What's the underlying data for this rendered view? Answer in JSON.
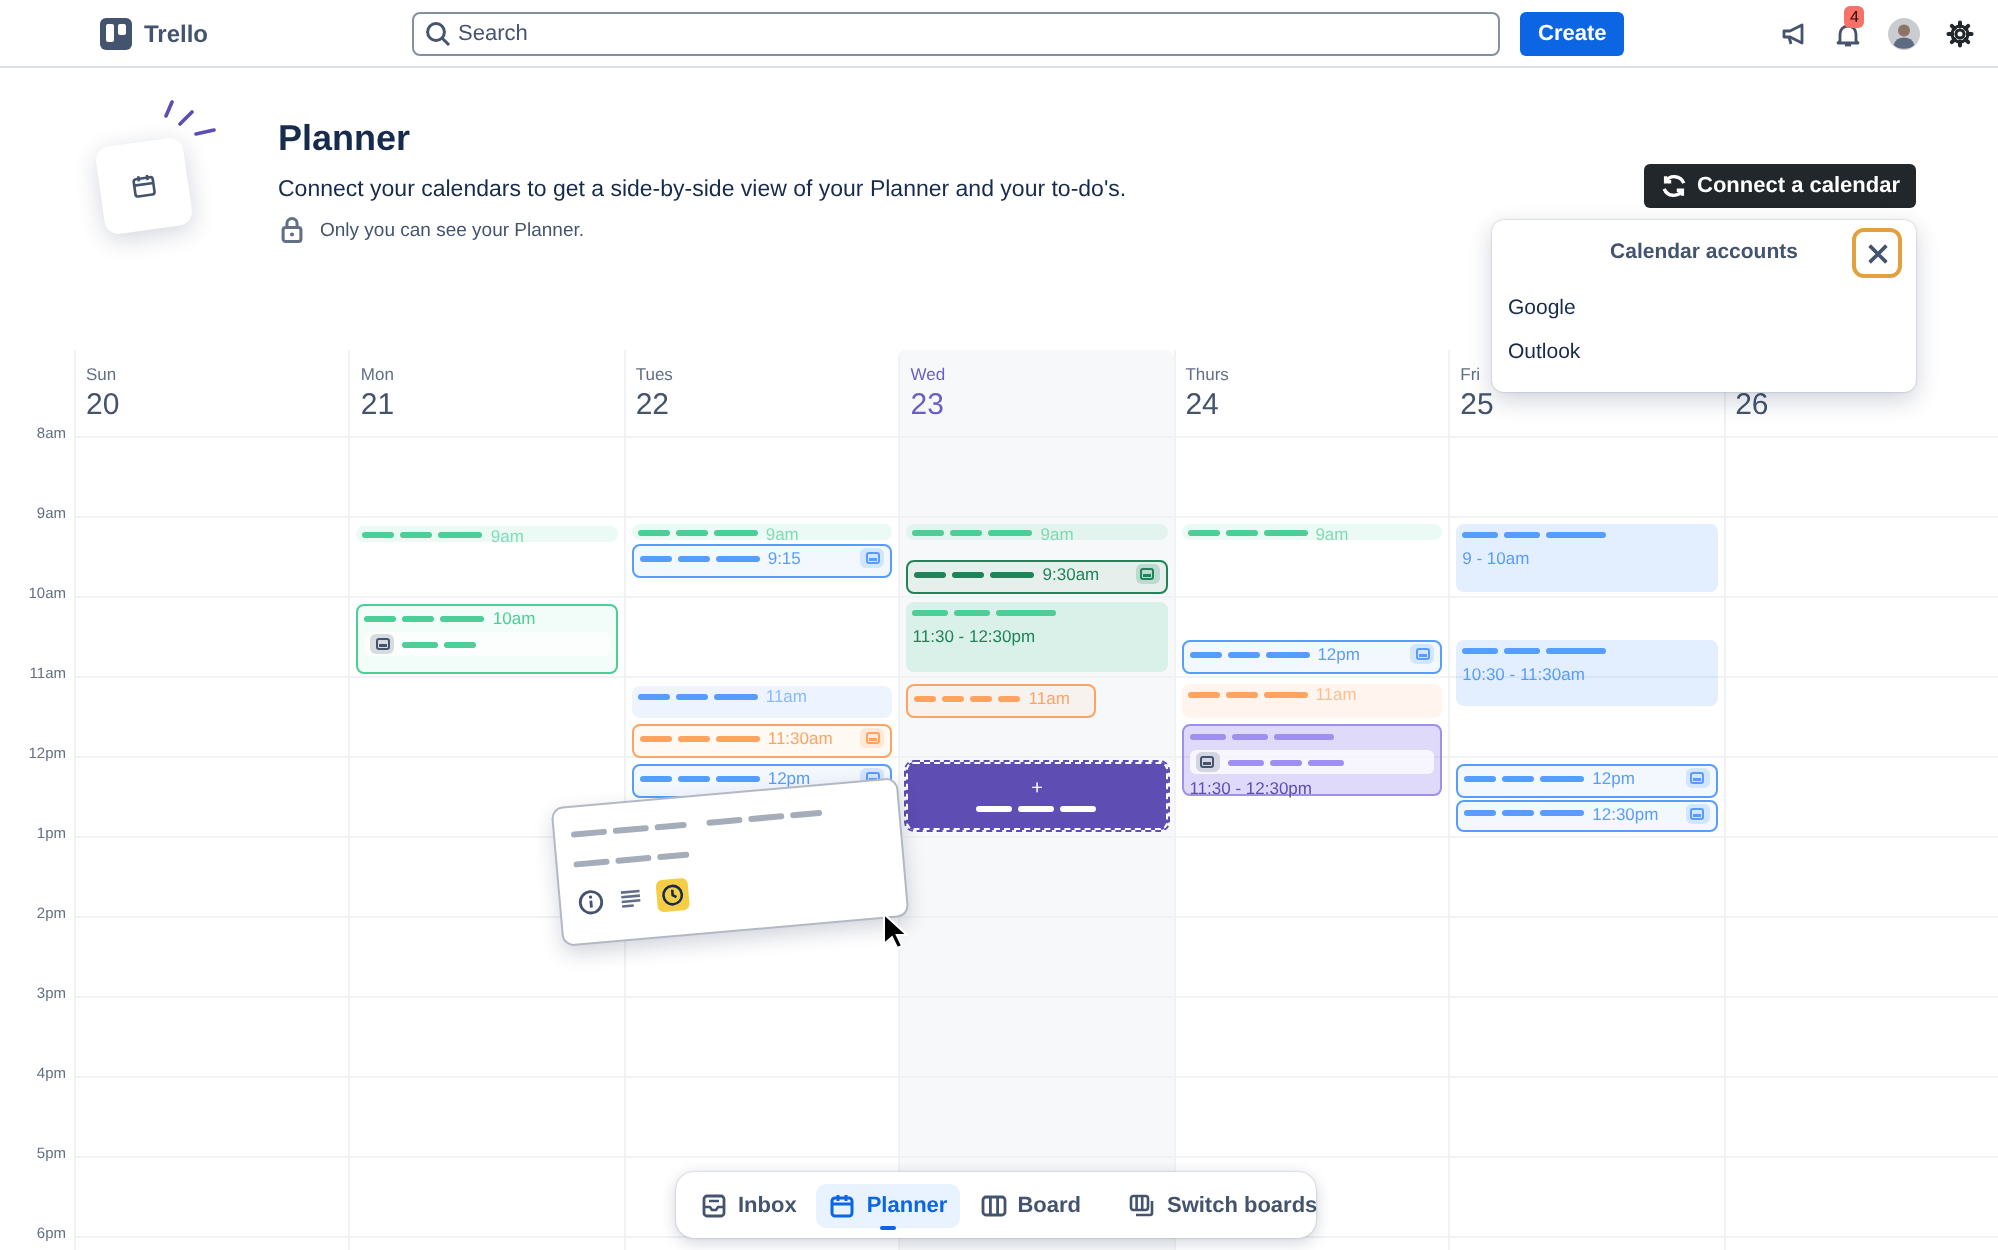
{
  "header": {
    "logo": "Trello",
    "search": {
      "placeholder": "Search"
    },
    "create_button": "Create",
    "notification_count": "4"
  },
  "hero": {
    "title": "Planner",
    "description": "Connect your calendars to get a side-by-side view of your Planner and your to-do's.",
    "privacy_note": "Only you can see your Planner.",
    "connect_button": "Connect a calendar"
  },
  "popover": {
    "title": "Calendar accounts",
    "items": [
      "Google",
      "Outlook"
    ]
  },
  "times": [
    "8am",
    "9am",
    "10am",
    "11am",
    "12pm",
    "1pm",
    "2pm",
    "3pm",
    "4pm",
    "5pm",
    "6pm"
  ],
  "days": [
    {
      "name": "Sun",
      "number": "20",
      "selected": false
    },
    {
      "name": "Mon",
      "number": "21",
      "selected": false,
      "events": [
        {
          "kind": "hint",
          "color": "#4bce97",
          "label": "9am",
          "card_icon": false,
          "inner_row": false
        },
        {
          "kind": "item",
          "color": "#4bce97",
          "label": "10am",
          "card_icon": false,
          "inner_row": true
        }
      ]
    },
    {
      "name": "Tues",
      "number": "22",
      "selected": false,
      "events": [
        {
          "kind": "hint",
          "color": "#4bce97",
          "label": "9am",
          "card_icon": false,
          "inner_row": false
        },
        {
          "kind": "item",
          "color": "#579dff",
          "label": "9:15",
          "card_icon": true,
          "inner_row": false
        },
        {
          "kind": "hint",
          "color": "#579dff",
          "label": "11am",
          "card_icon": false,
          "inner_row": false
        },
        {
          "kind": "item",
          "color": "#fea362",
          "label": "11:30am",
          "card_icon": true,
          "inner_row": false
        },
        {
          "kind": "item",
          "color": "#579dff",
          "label": "12pm",
          "card_icon": true,
          "inner_row": false
        }
      ]
    },
    {
      "name": "Wed",
      "number": "23",
      "selected": true,
      "events": [
        {
          "kind": "hint",
          "color": "#4bce97",
          "label": "9am",
          "card_icon": false,
          "inner_row": false
        },
        {
          "kind": "item",
          "color": "#1f845a",
          "label": "9:30am",
          "card_icon": true,
          "inner_row": false
        },
        {
          "kind": "note",
          "color": "#4bce97",
          "label": "11:30 - 12:30pm",
          "card_icon": false,
          "inner_row": false
        },
        {
          "kind": "item",
          "color": "#fea362",
          "label": "11am",
          "card_icon": false,
          "inner_row": false
        },
        {
          "kind": "slot",
          "color": "#5e4db2",
          "label": "+"
        }
      ]
    },
    {
      "name": "Thurs",
      "number": "24",
      "selected": false,
      "events": [
        {
          "kind": "hint",
          "color": "#4bce97",
          "label": "9am",
          "card_icon": false,
          "inner_row": false
        },
        {
          "kind": "item",
          "color": "#579dff",
          "label": "12pm",
          "card_icon": true,
          "inner_row": false
        },
        {
          "kind": "hint",
          "color": "#fea362",
          "label": "11am",
          "card_icon": false,
          "inner_row": false
        },
        {
          "kind": "group",
          "color": "#9f8fef",
          "label": "11:30 - 12:30pm",
          "card_icon": false,
          "inner_row": true
        }
      ]
    },
    {
      "name": "Fri",
      "number": "25",
      "selected": false,
      "events": [
        {
          "kind": "note",
          "color": "#579dff",
          "label": "9 - 10am",
          "card_icon": false,
          "inner_row": false
        },
        {
          "kind": "note",
          "color": "#579dff",
          "label": "10:30 - 11:30am",
          "card_icon": false,
          "inner_row": false
        },
        {
          "kind": "item",
          "color": "#579dff",
          "label": "12pm",
          "card_icon": true,
          "inner_row": false
        },
        {
          "kind": "item",
          "color": "#579dff",
          "label": "12:30pm",
          "card_icon": true,
          "inner_row": false
        }
      ]
    },
    {
      "number": "26",
      "selected": false
    }
  ],
  "nav": [
    {
      "kind": "inbox",
      "label": "Inbox",
      "selected": false
    },
    {
      "kind": "planner",
      "label": "Planner",
      "selected": true
    },
    {
      "kind": "board",
      "label": "Board",
      "selected": false
    },
    {
      "kind": "switch",
      "label": "Switch boards",
      "selected": false
    }
  ]
}
